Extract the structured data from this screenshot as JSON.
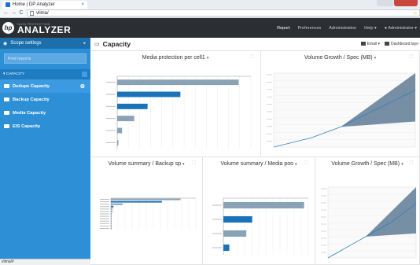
{
  "browser": {
    "tab_title": "Home | DP Analyzer",
    "tab_close": "×",
    "url": "vlima/",
    "nav": {
      "back": "←",
      "forward": "→",
      "reload": "C"
    },
    "bookmark_star": "☆"
  },
  "app": {
    "brand_small": "DATA PROTECTION",
    "brand_big": "ANALYZER",
    "hp_logo": "hp",
    "nav": [
      {
        "label": "Report",
        "active": true
      },
      {
        "label": "Preferences",
        "active": false
      },
      {
        "label": "Administration",
        "active": false
      },
      {
        "label": "Help ▾",
        "active": false
      },
      {
        "label": "Administrator ▾",
        "active": false
      }
    ]
  },
  "sidebar": {
    "scope_label": "Scope settings",
    "filter_placeholder": "Find reports",
    "section_label": "▾ CAPACITY",
    "items": [
      {
        "label": "Dedupe Capacity",
        "selected": true
      },
      {
        "label": "Backup Capacity",
        "selected": false
      },
      {
        "label": "Media Capacity",
        "selected": false
      },
      {
        "label": "EIS Capacity",
        "selected": false
      }
    ]
  },
  "status_bar": "vlima/#",
  "content": {
    "title": "Capacity",
    "email_label": "Email ▾",
    "dashboard_label": "Dashboard layo"
  },
  "panels": [
    {
      "title": "Media protection per cell1",
      "dd": "▾",
      "expand": "⛶"
    },
    {
      "title": "Volume Growth / Spec (MB)",
      "dd": "▾",
      "expand": "⛶"
    },
    {
      "title": "Volume summary / Backup sp",
      "dd": "▾",
      "expand": "⛶"
    },
    {
      "title": "Volume summary / Media poo",
      "dd": "▾",
      "expand": "⛶"
    },
    {
      "title": "Volume Growth / Spec (MB)",
      "dd": "▾",
      "expand": "⛶"
    }
  ],
  "colors": {
    "sidebar": "#2d8fd6",
    "appbar": "#2b2f33",
    "bar_dark": "#1a73b8",
    "bar_gray": "#8aa2b5",
    "area_fill": "#5f7b95"
  },
  "chart_data": [
    {
      "type": "bar",
      "orientation": "horizontal",
      "series": [
        {
          "values": [
            100,
            52,
            25,
            14,
            4,
            1
          ]
        }
      ],
      "xlim": [
        0,
        110
      ]
    },
    {
      "type": "line",
      "series": [
        {
          "values": [
            0,
            2,
            4,
            6,
            8,
            10,
            13,
            16,
            19,
            22,
            26,
            30,
            34,
            38,
            42,
            46,
            50,
            54,
            58,
            62
          ]
        }
      ]
    },
    {
      "type": "bar",
      "orientation": "horizontal",
      "series": [
        {
          "values": [
            82,
            60,
            14,
            3,
            2,
            2,
            1,
            1,
            1,
            1,
            1,
            1,
            1
          ]
        }
      ],
      "xlim": [
        0,
        100
      ]
    },
    {
      "type": "bar",
      "orientation": "horizontal",
      "series": [
        {
          "values": [
            95,
            34,
            27,
            7
          ]
        }
      ],
      "xlim": [
        0,
        100
      ]
    },
    {
      "type": "line",
      "series": [
        {
          "values": [
            0,
            3,
            6,
            9,
            12,
            15,
            18,
            21,
            24,
            27,
            30,
            34,
            38,
            42,
            46
          ]
        }
      ]
    }
  ]
}
